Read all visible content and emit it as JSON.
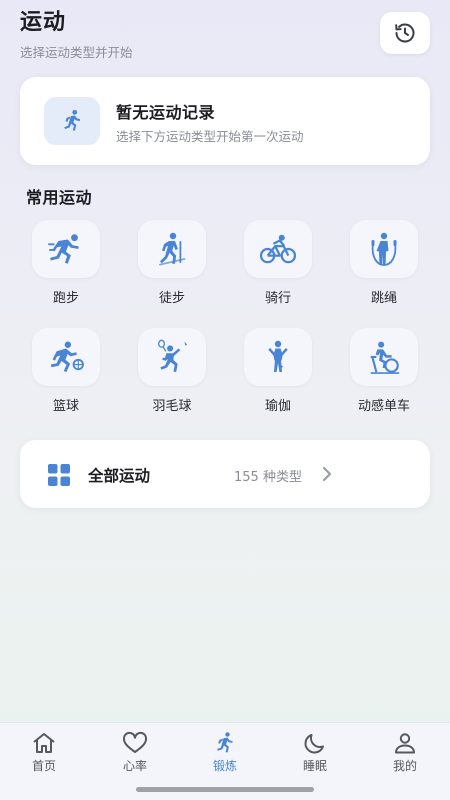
{
  "header": {
    "title": "运动",
    "subtitle": "选择运动类型并开始",
    "history_icon": "history-clock-icon"
  },
  "record_card": {
    "title": "暂无运动记录",
    "subtitle": "选择下方运动类型开始第一次运动",
    "icon": "running-person-icon"
  },
  "section": {
    "title": "常用运动"
  },
  "sports": [
    {
      "label": "跑步",
      "icon": "running-icon"
    },
    {
      "label": "徒步",
      "icon": "hiking-icon"
    },
    {
      "label": "骑行",
      "icon": "cycling-icon"
    },
    {
      "label": "跳绳",
      "icon": "jump-rope-icon"
    },
    {
      "label": "篮球",
      "icon": "basketball-icon"
    },
    {
      "label": "羽毛球",
      "icon": "badminton-icon"
    },
    {
      "label": "瑜伽",
      "icon": "yoga-icon"
    },
    {
      "label": "动感单车",
      "icon": "spinning-bike-icon"
    }
  ],
  "all_sports": {
    "label": "全部运动",
    "count": "155 种类型",
    "icon": "grid-icon"
  },
  "tabs": [
    {
      "label": "首页",
      "icon": "home-icon",
      "active": false
    },
    {
      "label": "心率",
      "icon": "heart-icon",
      "active": false
    },
    {
      "label": "锻炼",
      "icon": "running-icon",
      "active": true
    },
    {
      "label": "睡眠",
      "icon": "moon-icon",
      "active": false
    },
    {
      "label": "我的",
      "icon": "user-icon",
      "active": false
    }
  ],
  "colors": {
    "accent": "#4a84d4",
    "tile_bg": "#f4f6fb",
    "icon_tint_bg": "#e3ecf8"
  }
}
